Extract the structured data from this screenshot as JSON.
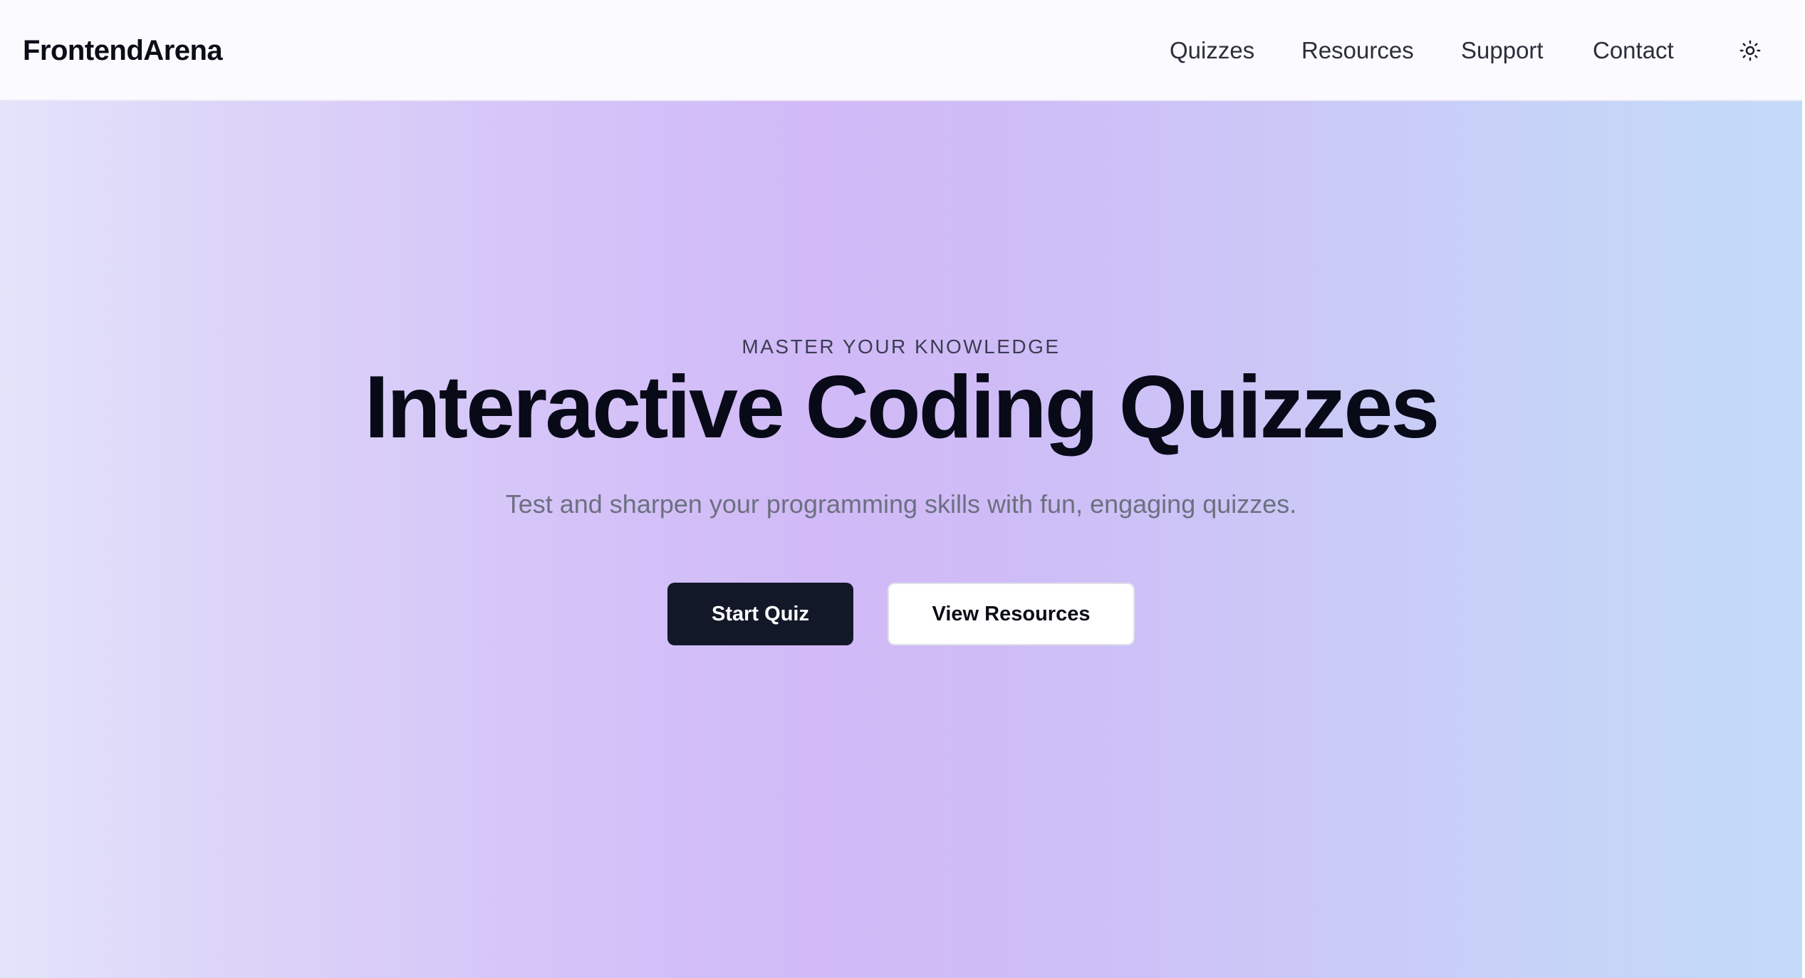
{
  "header": {
    "brand": "FrontendArena",
    "nav": [
      "Quizzes",
      "Resources",
      "Support",
      "Contact"
    ],
    "theme_icon": "sun-icon"
  },
  "hero": {
    "eyebrow": "MASTER YOUR KNOWLEDGE",
    "title": "Interactive Coding Quizzes",
    "subtitle": "Test and sharpen your programming skills with fun, engaging quizzes.",
    "primary_button": "Start Quiz",
    "secondary_button": "View Resources"
  },
  "colors": {
    "primary_button_bg": "#131829",
    "text_dark": "#080a18",
    "subtitle": "#6b7080"
  }
}
